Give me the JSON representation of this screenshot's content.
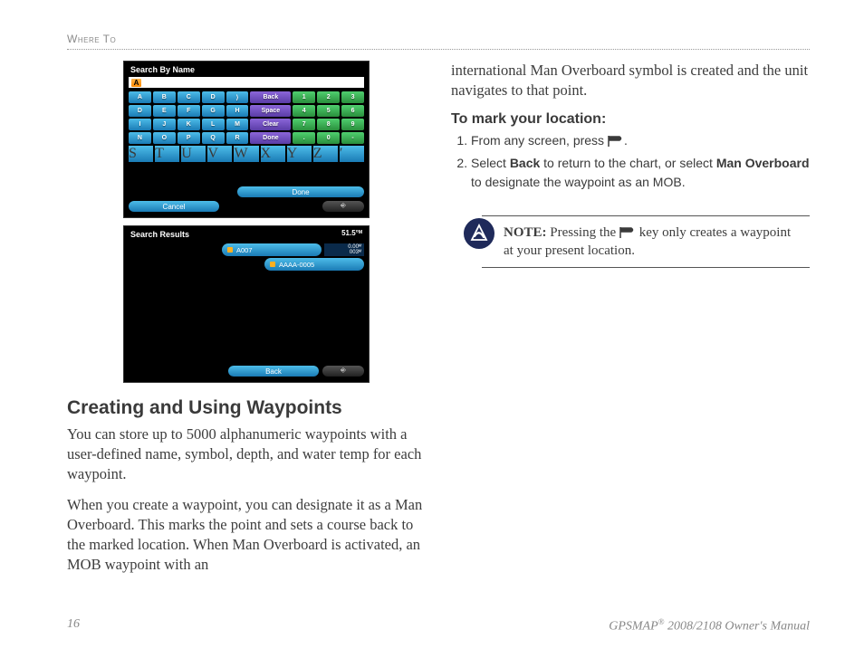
{
  "header": {
    "section": "Where To"
  },
  "screenshot1": {
    "title": "Search By Name",
    "entry": "A",
    "keys_letter_rows": [
      [
        "A",
        "B",
        "C",
        "D",
        "⟩"
      ],
      [
        "D",
        "E",
        "F",
        "G",
        "H"
      ],
      [
        "I",
        "J",
        "K",
        "L",
        "M"
      ],
      [
        "N",
        "O",
        "P",
        "Q",
        "R"
      ]
    ],
    "keys_action": [
      "Back",
      "Space",
      "Clear",
      "Done"
    ],
    "keys_num_rows": [
      [
        "1",
        "2",
        "3"
      ],
      [
        "4",
        "5",
        "6"
      ],
      [
        "7",
        "8",
        "9"
      ],
      [
        ".",
        "0",
        "-"
      ]
    ],
    "row6": [
      "S",
      "T",
      "U",
      "V",
      "W",
      "X",
      "Y",
      "Z",
      "′"
    ],
    "done": "Done",
    "cancel": "Cancel",
    "mode": "⎆"
  },
  "screenshot2": {
    "title": "Search Results",
    "heading": "51.5°ᴹ",
    "results": [
      {
        "name": "A007",
        "dist": "0.00ᴹ",
        "brg": "003ᴹ"
      },
      {
        "name": "AAAA-0005",
        "dist": "",
        "brg": ""
      }
    ],
    "back": "Back",
    "mode": "⎆"
  },
  "section_title": "Creating and Using Waypoints",
  "para1": "You can store up to 5000 alphanumeric waypoints with a user-defined name, symbol, depth, and water temp for each waypoint.",
  "para2": "When you create a waypoint, you can designate it as a Man Overboard. This marks the point and sets a course back to the marked location. When Man Overboard is activated, an MOB waypoint with an",
  "para3": "international Man Overboard symbol is created and the unit navigates to that point.",
  "steps_title": "To mark your location:",
  "step1_pre": "From any screen, press ",
  "step1_post": ".",
  "step2_a": "Select ",
  "step2_b": "Back",
  "step2_c": " to return to the chart, or select ",
  "step2_d": "Man Overboard",
  "step2_e": " to designate the waypoint as an MOB.",
  "note_label": "NOTE:",
  "note_a": " Pressing the ",
  "note_b": " key only creates a waypoint at your present location.",
  "footer": {
    "page": "16",
    "product_a": "GPSMAP",
    "product_b": " 2008/2108  Owner's Manual"
  }
}
